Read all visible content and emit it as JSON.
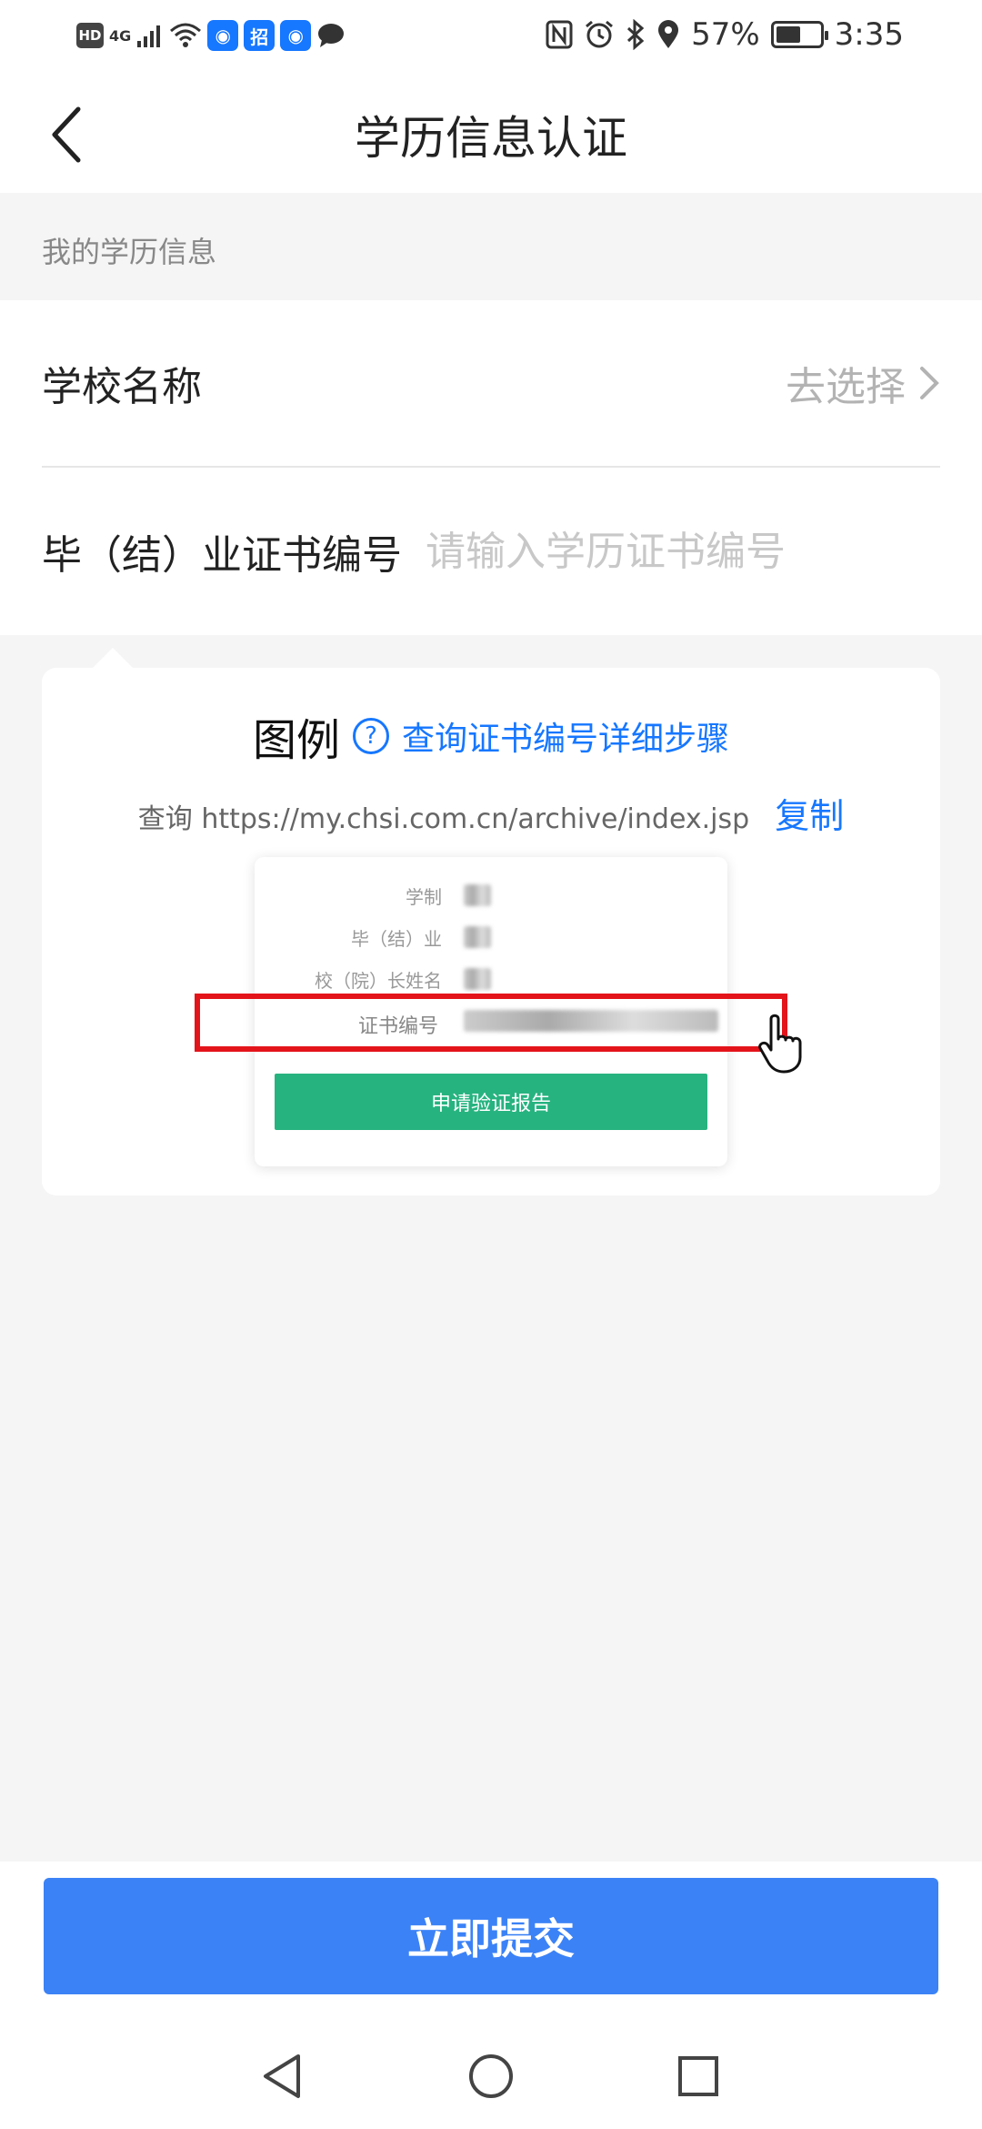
{
  "status_bar": {
    "network": "4G",
    "hd": "HD",
    "app_badge": "招",
    "battery": "57%",
    "battery_level": 0.57,
    "time": "3:35"
  },
  "header": {
    "title": "学历信息认证"
  },
  "section": {
    "label": "我的学历信息"
  },
  "form": {
    "school_label": "学校名称",
    "school_value": "去选择",
    "cert_label": "毕（结）业证书编号",
    "cert_placeholder": "请输入学历证书编号",
    "cert_value": ""
  },
  "example": {
    "title": "图例",
    "help_icon": "?",
    "steps_link": "查询证书编号详细步骤",
    "query_text": "查询 https://my.chsi.com.cn/archive/index.jsp",
    "copy_label": "复制",
    "illustration": {
      "rows": [
        "学制",
        "毕（结）业",
        "校（院）长姓名"
      ],
      "highlight_label": "证书编号",
      "apply_button": "申请验证报告",
      "highlight_color": "#e4141b",
      "apply_color": "#27b380"
    }
  },
  "submit": {
    "label": "立即提交",
    "color": "#3b82f6"
  },
  "nav": {
    "icons": [
      "back-triangle-icon",
      "home-circle-icon",
      "recents-square-icon"
    ]
  }
}
